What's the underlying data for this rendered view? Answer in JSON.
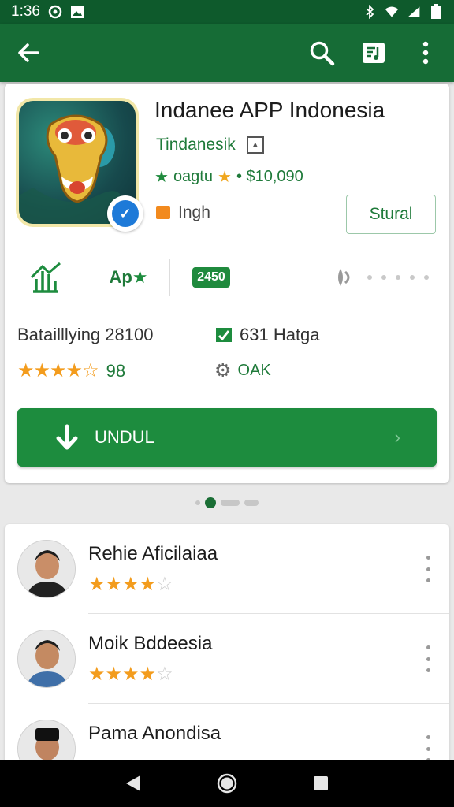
{
  "status_bar": {
    "time": "1:36",
    "icons": [
      "notification-icon",
      "image-icon",
      "bluetooth-icon",
      "wifi-icon",
      "signal-icon",
      "battery-icon"
    ]
  },
  "toolbar": {
    "back_icon": "arrow-back-icon",
    "search_icon": "search-icon",
    "playlist_icon": "playlist-icon",
    "more_icon": "more-vert-icon",
    "bg_color": "#166c36"
  },
  "app": {
    "title": "Indanee APP Indonesia",
    "developer": "Tindanesik",
    "rating_text": "oagtu",
    "price": "• $10,090",
    "language": "Ingh",
    "install_label": "Stural",
    "accent": "#1d8c3e"
  },
  "meta": {
    "apk_label": "Ap",
    "size_badge": "2450"
  },
  "stats": {
    "downloads": "Batailllying 28100",
    "rating_value": "98",
    "rating_stars": "★★★★☆",
    "age_label": "631 Hatga",
    "status_label": "OAK"
  },
  "download_button": {
    "label": "UNDUL",
    "chevron": "›"
  },
  "reviews": [
    {
      "name": "Rehie Aficilaiaa",
      "stars_full": "★★★★",
      "stars_empty": "☆"
    },
    {
      "name": "Moik Bddeesia",
      "stars_full": "★★★★",
      "stars_empty": "☆"
    },
    {
      "name": "Pama Anondisa",
      "stars_full": "",
      "stars_empty": ""
    }
  ]
}
